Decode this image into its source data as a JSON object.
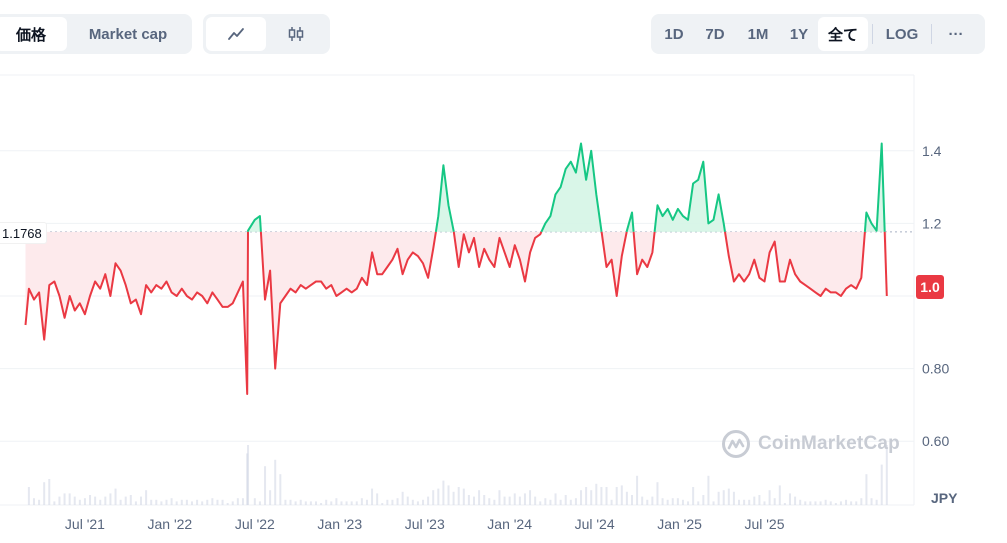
{
  "toolbar": {
    "mode_tabs": [
      {
        "label": "価格",
        "active": true
      },
      {
        "label": "Market cap",
        "active": false
      }
    ],
    "chart_types": [
      {
        "icon": "line-chart-icon",
        "active": true
      },
      {
        "icon": "candlestick-icon",
        "active": false
      }
    ],
    "ranges": [
      "1D",
      "7D",
      "1M",
      "1Y",
      "全て"
    ],
    "active_range": "全て",
    "log_label": "LOG",
    "more_label": "···"
  },
  "reference": {
    "label": "1.1768",
    "value": 1.1768
  },
  "current_price": {
    "label": "1.0"
  },
  "watermark": {
    "text": "CoinMarketCap"
  },
  "currency_unit": "JPY",
  "colors": {
    "up": "#16c784",
    "down": "#ea3943",
    "up_fill": "#d5f5e6",
    "down_fill": "#fde8ea",
    "grid": "#eff2f5",
    "volume": "#cfd6e4"
  },
  "chart_data": {
    "type": "line",
    "y_ticks": [
      "1.4",
      "1.2",
      "1.0",
      "0.80",
      "0.60"
    ],
    "y_tick_values": [
      1.4,
      1.2,
      1.0,
      0.8,
      0.6
    ],
    "ylim": [
      0.6,
      1.4
    ],
    "x_ticks": [
      "Jul '21",
      "Jan '22",
      "Jul '22",
      "Jan '23",
      "Jul '23",
      "Jan '24",
      "Jul '24",
      "Jan '25",
      "Jul '25"
    ],
    "xlim": [
      "2021-03",
      "2025-09"
    ],
    "baseline": 1.1768,
    "series": [
      {
        "values": [
          [
            2021.25,
            0.92
          ],
          [
            2021.27,
            1.02
          ],
          [
            2021.3,
            0.99
          ],
          [
            2021.33,
            1.01
          ],
          [
            2021.36,
            0.88
          ],
          [
            2021.39,
            1.03
          ],
          [
            2021.42,
            1.04
          ],
          [
            2021.45,
            1.0
          ],
          [
            2021.48,
            0.94
          ],
          [
            2021.51,
            1.0
          ],
          [
            2021.54,
            0.96
          ],
          [
            2021.57,
            0.98
          ],
          [
            2021.6,
            0.95
          ],
          [
            2021.63,
            1.0
          ],
          [
            2021.66,
            1.04
          ],
          [
            2021.69,
            1.02
          ],
          [
            2021.72,
            1.06
          ],
          [
            2021.75,
            1.0
          ],
          [
            2021.78,
            1.09
          ],
          [
            2021.81,
            1.07
          ],
          [
            2021.84,
            1.03
          ],
          [
            2021.87,
            0.98
          ],
          [
            2021.9,
            0.99
          ],
          [
            2021.93,
            0.95
          ],
          [
            2021.96,
            1.03
          ],
          [
            2021.99,
            1.01
          ],
          [
            2022.02,
            1.03
          ],
          [
            2022.05,
            1.02
          ],
          [
            2022.08,
            1.04
          ],
          [
            2022.11,
            1.01
          ],
          [
            2022.14,
            1.0
          ],
          [
            2022.17,
            1.02
          ],
          [
            2022.2,
            1.0
          ],
          [
            2022.23,
            0.99
          ],
          [
            2022.26,
            1.01
          ],
          [
            2022.29,
            1.0
          ],
          [
            2022.32,
            0.98
          ],
          [
            2022.35,
            1.01
          ],
          [
            2022.38,
            0.99
          ],
          [
            2022.41,
            0.97
          ],
          [
            2022.44,
            0.97
          ],
          [
            2022.47,
            0.98
          ],
          [
            2022.5,
            1.01
          ],
          [
            2022.53,
            1.04
          ],
          [
            2022.555,
            0.73
          ],
          [
            2022.56,
            1.18
          ],
          [
            2022.6,
            1.21
          ],
          [
            2022.63,
            1.22
          ],
          [
            2022.66,
            0.99
          ],
          [
            2022.69,
            1.07
          ],
          [
            2022.72,
            0.8
          ],
          [
            2022.75,
            0.98
          ],
          [
            2022.78,
            1.0
          ],
          [
            2022.81,
            1.02
          ],
          [
            2022.84,
            1.01
          ],
          [
            2022.87,
            1.03
          ],
          [
            2022.9,
            1.02
          ],
          [
            2022.93,
            1.03
          ],
          [
            2022.96,
            1.04
          ],
          [
            2022.99,
            1.04
          ],
          [
            2023.02,
            1.02
          ],
          [
            2023.05,
            1.03
          ],
          [
            2023.08,
            1.0
          ],
          [
            2023.11,
            1.01
          ],
          [
            2023.14,
            1.02
          ],
          [
            2023.17,
            1.01
          ],
          [
            2023.2,
            1.02
          ],
          [
            2023.23,
            1.05
          ],
          [
            2023.26,
            1.03
          ],
          [
            2023.29,
            1.12
          ],
          [
            2023.32,
            1.06
          ],
          [
            2023.35,
            1.06
          ],
          [
            2023.38,
            1.08
          ],
          [
            2023.41,
            1.1
          ],
          [
            2023.44,
            1.13
          ],
          [
            2023.47,
            1.06
          ],
          [
            2023.5,
            1.1
          ],
          [
            2023.53,
            1.12
          ],
          [
            2023.56,
            1.11
          ],
          [
            2023.59,
            1.09
          ],
          [
            2023.62,
            1.05
          ],
          [
            2023.65,
            1.13
          ],
          [
            2023.68,
            1.22
          ],
          [
            2023.71,
            1.36
          ],
          [
            2023.74,
            1.25
          ],
          [
            2023.77,
            1.18
          ],
          [
            2023.8,
            1.08
          ],
          [
            2023.83,
            1.17
          ],
          [
            2023.86,
            1.12
          ],
          [
            2023.89,
            1.16
          ],
          [
            2023.92,
            1.08
          ],
          [
            2023.95,
            1.13
          ],
          [
            2023.98,
            1.1
          ],
          [
            2024.01,
            1.08
          ],
          [
            2024.04,
            1.16
          ],
          [
            2024.07,
            1.12
          ],
          [
            2024.1,
            1.08
          ],
          [
            2024.13,
            1.14
          ],
          [
            2024.16,
            1.1
          ],
          [
            2024.19,
            1.04
          ],
          [
            2024.22,
            1.12
          ],
          [
            2024.25,
            1.16
          ],
          [
            2024.28,
            1.17
          ],
          [
            2024.31,
            1.2
          ],
          [
            2024.34,
            1.22
          ],
          [
            2024.37,
            1.28
          ],
          [
            2024.4,
            1.3
          ],
          [
            2024.43,
            1.35
          ],
          [
            2024.46,
            1.37
          ],
          [
            2024.49,
            1.34
          ],
          [
            2024.52,
            1.42
          ],
          [
            2024.55,
            1.32
          ],
          [
            2024.58,
            1.4
          ],
          [
            2024.61,
            1.28
          ],
          [
            2024.64,
            1.18
          ],
          [
            2024.67,
            1.08
          ],
          [
            2024.7,
            1.1
          ],
          [
            2024.73,
            1.0
          ],
          [
            2024.76,
            1.11
          ],
          [
            2024.79,
            1.18
          ],
          [
            2024.82,
            1.23
          ],
          [
            2024.85,
            1.06
          ],
          [
            2024.88,
            1.1
          ],
          [
            2024.91,
            1.08
          ],
          [
            2024.94,
            1.12
          ],
          [
            2024.97,
            1.25
          ],
          [
            2025.0,
            1.22
          ],
          [
            2025.03,
            1.24
          ],
          [
            2025.06,
            1.21
          ],
          [
            2025.09,
            1.24
          ],
          [
            2025.12,
            1.22
          ],
          [
            2025.15,
            1.21
          ],
          [
            2025.18,
            1.31
          ],
          [
            2025.21,
            1.32
          ],
          [
            2025.24,
            1.37
          ],
          [
            2025.27,
            1.2
          ],
          [
            2025.3,
            1.21
          ],
          [
            2025.33,
            1.28
          ],
          [
            2025.36,
            1.2
          ],
          [
            2025.39,
            1.11
          ],
          [
            2025.42,
            1.04
          ],
          [
            2025.45,
            1.06
          ],
          [
            2025.48,
            1.04
          ],
          [
            2025.51,
            1.06
          ],
          [
            2025.54,
            1.1
          ],
          [
            2025.57,
            1.05
          ],
          [
            2025.6,
            1.04
          ],
          [
            2025.63,
            1.12
          ],
          [
            2025.66,
            1.15
          ],
          [
            2025.69,
            1.04
          ],
          [
            2025.72,
            1.04
          ],
          [
            2025.75,
            1.1
          ],
          [
            2025.78,
            1.06
          ],
          [
            2025.81,
            1.04
          ],
          [
            2025.84,
            1.03
          ],
          [
            2025.87,
            1.02
          ],
          [
            2025.9,
            1.01
          ],
          [
            2025.93,
            1.0
          ],
          [
            2025.96,
            1.02
          ],
          [
            2025.99,
            1.01
          ],
          [
            2026.02,
            1.01
          ],
          [
            2026.05,
            1.0
          ],
          [
            2026.08,
            1.02
          ],
          [
            2026.11,
            1.03
          ],
          [
            2026.14,
            1.02
          ],
          [
            2026.17,
            1.05
          ],
          [
            2026.2,
            1.23
          ],
          [
            2026.23,
            1.2
          ],
          [
            2026.26,
            1.18
          ],
          [
            2026.29,
            1.42
          ],
          [
            2026.32,
            1.0
          ]
        ]
      }
    ]
  }
}
